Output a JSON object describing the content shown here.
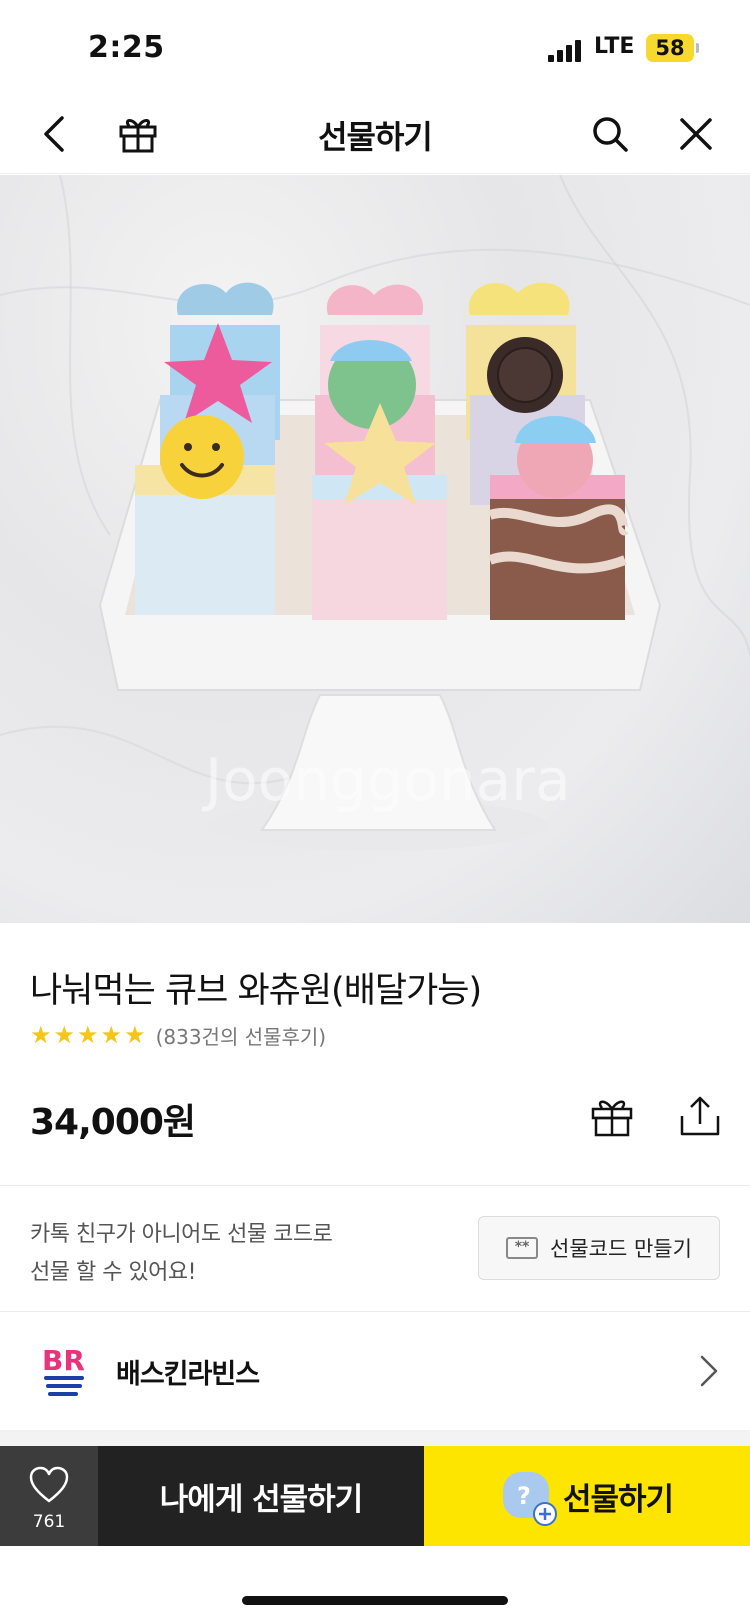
{
  "status_bar": {
    "time": "2:25",
    "network": "LTE",
    "battery": "58"
  },
  "header": {
    "title": "선물하기",
    "icons": [
      "back-chevron-icon",
      "gift-box-icon",
      "search-icon",
      "close-icon"
    ]
  },
  "hero": {
    "watermark": "Joonggonara"
  },
  "product": {
    "name": "나눠먹는 큐브 와츄원(배달가능)",
    "rating": 5,
    "review_count": "(833건의 선물후기)",
    "price": "34,000원"
  },
  "gift_code": {
    "info_line1": "카톡 친구가 아니어도 선물 코드로",
    "info_line2": "선물 할 수 있어요!",
    "icon_text": "**",
    "button_label": "선물코드 만들기"
  },
  "brand": {
    "name": "배스킨라빈스",
    "logo_text": "BR"
  },
  "bottom_bar": {
    "like_count": "761",
    "self_gift_label": "나에게 선물하기",
    "gift_label": "선물하기",
    "avatar_glyph": "?"
  },
  "colors": {
    "accent": "#fee500",
    "star": "#f5c518",
    "dark": "#222222",
    "brand_blue": "#1e3fa8",
    "brand_pink": "#e8347a"
  }
}
